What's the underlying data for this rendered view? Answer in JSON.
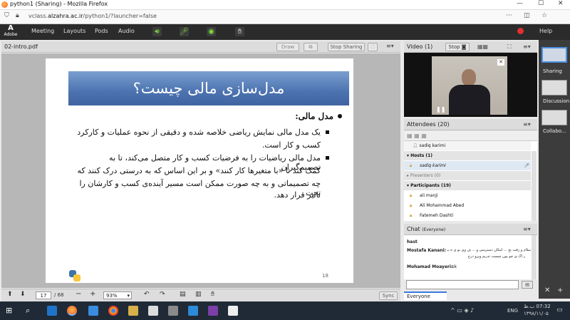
{
  "browser": {
    "tab_title": "python1 (Sharing) - Mozilla Firefox",
    "url_prefix": "vclass.",
    "url_domain": "alzahra.ac.ir",
    "url_path": "/python1/?launcher=false"
  },
  "menu": {
    "meeting": "Meeting",
    "layouts": "Layouts",
    "pods": "Pods",
    "audio": "Audio",
    "help": "Help",
    "adobe": "Adobe"
  },
  "share": {
    "file": "02-intro.pdf",
    "draw": "Draw",
    "stop_sharing": "Stop Sharing"
  },
  "slide": {
    "title": "مدل‌سازی مالی چیست؟",
    "heading": "مدل مالی:",
    "b1_l1": "یک مدل مالی نمایش ریاضی خلاصه شده و دقیقی از نحوه عملیات و کارکرد",
    "b1_l2": "کسب و کار است.",
    "b2_l1": "مدل مالی ریاضیات را به فرضیات کسب و کار متصل می‌کند، تا به تصمیم‌گیران",
    "b2_l2": "کمک کند تا «با متغیرها کار کنند» و بر این اساس که به درستی درک کنند  که",
    "b2_l3": "چه تصمیماتی و به چه صورت ممکن است مسیر آینده‌ی کسب و کارشان را تحت",
    "b2_l4": "تاثیر قرار دهد.",
    "page": "18"
  },
  "pager": {
    "current": "17",
    "total": "/ 68",
    "zoom": "93%",
    "sync": "Sync"
  },
  "video": {
    "title": "Video",
    "count": "(1)",
    "stop": "Stop"
  },
  "attendees": {
    "title": "Attendees",
    "count": "(20)",
    "me": "sadiq karimi",
    "hosts": "Hosts (1)",
    "host1": "sadiq karimi",
    "presenters": "Presenters (0)",
    "participants": "Participants (19)",
    "p1": "ali manji",
    "p2": "Ali Mohammad Abed",
    "p3": "Fatemeh Dashti"
  },
  "chat": {
    "title": "Chat",
    "scope": "(Everyone)",
    "m1_name": "hast",
    "m2_name": "Mostafa Kanani:",
    "m2_text": "سلام و رقت بخ ... امکان دسترسی و ... ف وی بو ی ه ب ور",
    "m2_text2": "ر اگ ی چو بون چبست تدریم ویرو درح",
    "m3_name": "Mohamad Moayeri:",
    "m3_text": "ok",
    "tab": "Everyone"
  },
  "sidebar": {
    "sharing": "Sharing",
    "discussion": "Discussion",
    "collab": "Collabo..."
  },
  "taskbar": {
    "lang": "ENG",
    "time": "07:32 ب.ظ",
    "date": "۱۳۹۸/۱۱/۰۵"
  }
}
